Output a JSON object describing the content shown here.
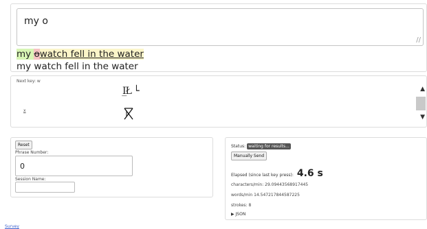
{
  "typed_text": "my o",
  "comparison": {
    "correct": "my ",
    "wrong": "o",
    "remaining": "watch fell in the water"
  },
  "target_phrase": "my watch fell in the water",
  "keyboard": {
    "next_key_label": "Next key: w",
    "glyph_top": "I̲Ł └",
    "glyph_bottom": "Ŧ",
    "x_label": "x"
  },
  "controls": {
    "reset_label": "Reset",
    "phrase_number_label": "Phrase Number:",
    "phrase_number_value": "0",
    "session_name_label": "Session Name:",
    "session_name_value": ""
  },
  "results": {
    "status_label": "Status:",
    "status_value": "waiting for results...",
    "manual_send_label": "Manually Send",
    "elapsed_label": "Elapsed (since last key press):",
    "elapsed_value": "4.6 s",
    "cpm_text": "characters/min: 29.09443568917445",
    "wpm_text": "words/min 14.547217844587225",
    "strokes_text": "strokes: 8",
    "json_label": "▶ JSON"
  },
  "footer": {
    "survey_label": "Survey"
  },
  "colors": {
    "correct_bg": "#d7f5b4",
    "wrong_bg": "#f6c3c3",
    "remaining_bg": "#fbf5c9"
  }
}
